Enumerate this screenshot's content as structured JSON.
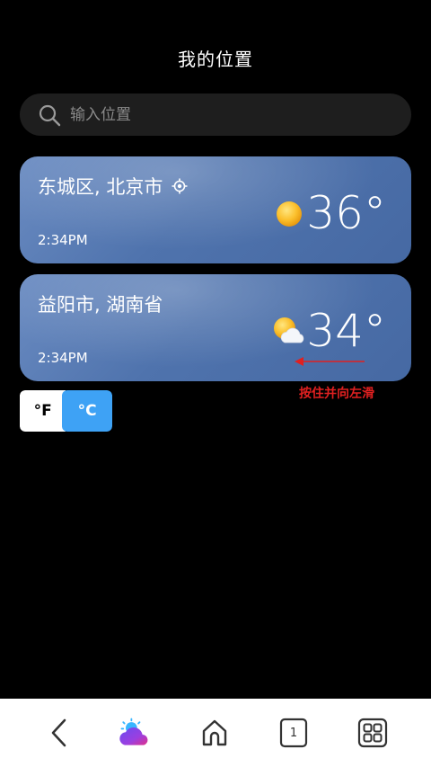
{
  "header": {
    "title": "我的位置"
  },
  "search": {
    "placeholder": "输入位置",
    "icon": "search-icon"
  },
  "locations": [
    {
      "city": "东城区, 北京市",
      "time": "2:34PM",
      "temp": "36°",
      "condition": "sunny",
      "is_current": true
    },
    {
      "city": "益阳市, 湖南省",
      "time": "2:34PM",
      "temp": "34°",
      "condition": "partly-cloudy",
      "is_current": false
    }
  ],
  "hint": {
    "text": "按住并向左滑"
  },
  "units": {
    "fahrenheit": "°F",
    "celsius": "°C",
    "selected": "celsius"
  },
  "nav": {
    "tab_count": "1"
  },
  "colors": {
    "accent": "#3ea2f5",
    "card": "#5577b0",
    "hint": "#e02020",
    "background": "#000000"
  }
}
